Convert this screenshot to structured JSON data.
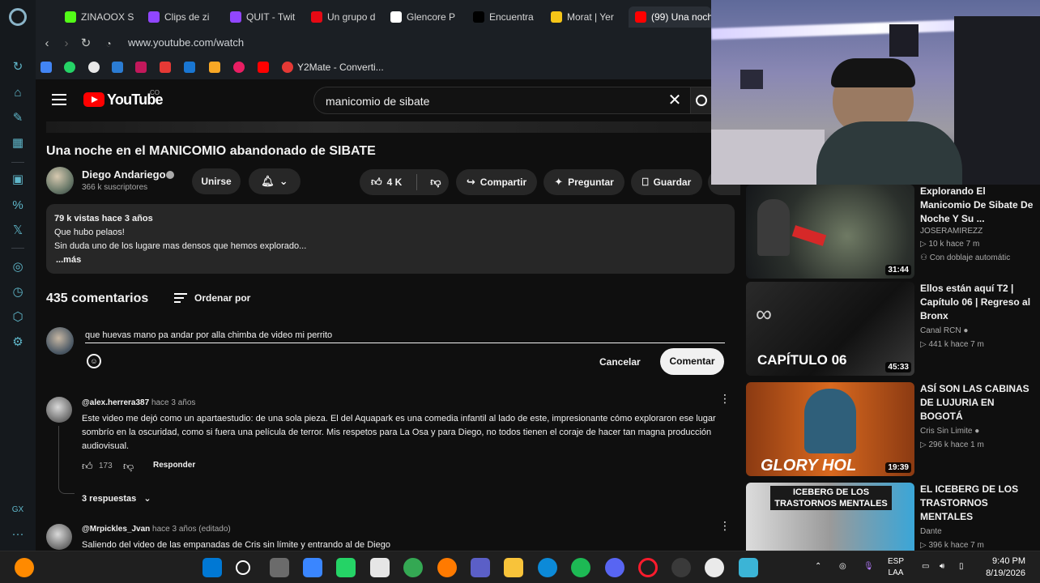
{
  "browser": {
    "tabs": [
      {
        "label": "ZINAOOX S",
        "color": "#53fc18"
      },
      {
        "label": "Clips de zi",
        "color": "#9146ff"
      },
      {
        "label": "QUIT - Twit",
        "color": "#9146ff"
      },
      {
        "label": "Un grupo d",
        "color": "#e50914"
      },
      {
        "label": "Glencore P",
        "color": "#ffffff"
      },
      {
        "label": "Encuentra",
        "color": "#000000"
      },
      {
        "label": "Morat | Yer",
        "color": "#f5c518"
      },
      {
        "label": "(99) Una noch",
        "color": "#ff0000",
        "active": true
      }
    ],
    "url": "www.youtube.com/watch",
    "bookmark_label": "Y2Mate - Converti..."
  },
  "youtube": {
    "wordmark": "YouTube",
    "country": "CO",
    "search_query": "manicomio de sibate"
  },
  "video": {
    "title": "Una noche en el MANICOMIO abandonado de SIBATE",
    "channel": "Diego Andariego",
    "subscribers": "366 k suscriptores",
    "join_label": "Unirse",
    "likes": "4 K",
    "share_label": "Compartir",
    "ask_label": "Preguntar",
    "save_label": "Guardar"
  },
  "description": {
    "stats": "79 k vistas  hace 3 años",
    "line1": "Que hubo pelaos!",
    "line2": "Sin duda uno de los lugare mas densos que hemos explorado...",
    "more": "...más"
  },
  "comments": {
    "count_label": "435 comentarios",
    "sort_label": "Ordenar por",
    "draft": "que huevas mano pa andar por alla chimba de video mi perrito",
    "cancel_label": "Cancelar",
    "submit_label": "Comentar",
    "items": [
      {
        "author": "@alex.herrera387",
        "time": "hace 3 años",
        "text": "Este video me dejó como un apartaestudio: de una sola pieza. El del Aquapark es una comedia infantil al lado de este, impresionante cómo exploraron ese lugar sombrío en la oscuridad, como si fuera una película de terror. Mis respetos para La Osa y para Diego, no todos tienen el coraje de hacer tan magna producción audiovisual.",
        "likes": "173",
        "reply_label": "Responder",
        "replies_label": "3 respuestas"
      },
      {
        "author": "@Mrpickles_Jvan",
        "time": "hace 3 años (editado)",
        "text": "Saliendo del video de las empanadas de Cris sin límite y entrando al de Diego"
      }
    ]
  },
  "recommendations": [
    {
      "title": "Explorando El Manicomio De Sibate De Noche Y Su ...",
      "channel": "JOSERAMIREZZ",
      "meta": "▷ 10 k  hace 7 m",
      "badge": "Con doblaje automátic",
      "duration": "31:44",
      "thumb_bg": "#2a2e2c"
    },
    {
      "title": "Ellos están aquí T2 | Capítulo 06 | Regreso al Bronx",
      "channel": "Canal RCN",
      "meta": "▷ 441 k  hace 7 m",
      "duration": "45:33",
      "thumb_text": "CAPÍTULO 06",
      "thumb_bg": "#1e1e1e"
    },
    {
      "title": "ASÍ SON LAS CABINAS DE LUJURIA EN BOGOTÁ",
      "channel": "Cris Sin Limite",
      "meta": "▷ 296 k  hace 1 m",
      "duration": "19:39",
      "thumb_text": "GLORY HOL",
      "thumb_bg": "#c8501a"
    },
    {
      "title": "EL ICEBERG DE LOS TRASTORNOS MENTALES",
      "channel": "Dante",
      "meta": "▷ 396 k  hace 7 m",
      "thumb_text": "ICEBERG DE LOS TRASTORNOS MENTALES",
      "thumb_bg": "#d8d8d8"
    }
  ],
  "taskbar": {
    "lang": "ESP",
    "lang_sub": "LAA",
    "time": "9:40 PM",
    "date": "8/19/2026"
  }
}
